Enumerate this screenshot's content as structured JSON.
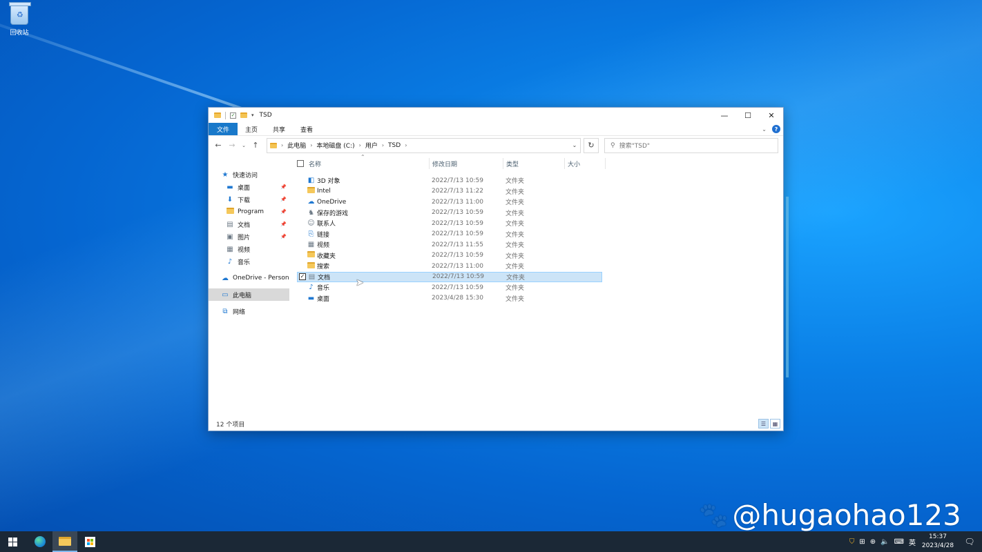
{
  "desktop": {
    "icons": [
      {
        "label": "回收站",
        "icon": "recycle-bin-icon"
      }
    ],
    "watermark": "@hugaohao123"
  },
  "window": {
    "title": "TSD",
    "ribbon_tabs": [
      "文件",
      "主页",
      "共享",
      "查看"
    ],
    "breadcrumb": [
      "此电脑",
      "本地磁盘 (C:)",
      "用户",
      "TSD"
    ],
    "search_placeholder": "搜索\"TSD\"",
    "nav": [
      {
        "label": "快速访问",
        "icon": "star-icon",
        "level": "top",
        "pinned": false
      },
      {
        "label": "桌面",
        "icon": "desktop-icon",
        "level": "sub",
        "pinned": true
      },
      {
        "label": "下载",
        "icon": "download-icon",
        "level": "sub",
        "pinned": true
      },
      {
        "label": "Program",
        "icon": "folder-icon",
        "level": "sub",
        "pinned": true
      },
      {
        "label": "文档",
        "icon": "document-icon",
        "level": "sub",
        "pinned": true
      },
      {
        "label": "图片",
        "icon": "picture-icon",
        "level": "sub",
        "pinned": true
      },
      {
        "label": "视频",
        "icon": "video-icon",
        "level": "sub",
        "pinned": false
      },
      {
        "label": "音乐",
        "icon": "music-icon",
        "level": "sub",
        "pinned": false
      },
      {
        "label": "OneDrive - Persona",
        "icon": "cloud-icon",
        "level": "top",
        "pinned": false
      },
      {
        "label": "此电脑",
        "icon": "computer-icon",
        "level": "top",
        "pinned": false,
        "selected": true
      },
      {
        "label": "网络",
        "icon": "network-icon",
        "level": "top",
        "pinned": false
      }
    ],
    "columns": [
      "名称",
      "修改日期",
      "类型",
      "大小"
    ],
    "files": [
      {
        "name": "3D 对象",
        "date": "2022/7/13 10:59",
        "type": "文件夹",
        "icon": "3d-objects-icon"
      },
      {
        "name": "Intel",
        "date": "2022/7/13 11:22",
        "type": "文件夹",
        "icon": "folder-icon"
      },
      {
        "name": "OneDrive",
        "date": "2022/7/13 11:00",
        "type": "文件夹",
        "icon": "cloud-icon"
      },
      {
        "name": "保存的游戏",
        "date": "2022/7/13 10:59",
        "type": "文件夹",
        "icon": "saved-games-icon"
      },
      {
        "name": "联系人",
        "date": "2022/7/13 10:59",
        "type": "文件夹",
        "icon": "contacts-icon"
      },
      {
        "name": "链接",
        "date": "2022/7/13 10:59",
        "type": "文件夹",
        "icon": "links-icon"
      },
      {
        "name": "视频",
        "date": "2022/7/13 11:55",
        "type": "文件夹",
        "icon": "video-icon"
      },
      {
        "name": "收藏夹",
        "date": "2022/7/13 10:59",
        "type": "文件夹",
        "icon": "favorites-icon"
      },
      {
        "name": "搜索",
        "date": "2022/7/13 11:00",
        "type": "文件夹",
        "icon": "search-folder-icon"
      },
      {
        "name": "文档",
        "date": "2022/7/13 10:59",
        "type": "文件夹",
        "icon": "document-icon",
        "selected": true
      },
      {
        "name": "音乐",
        "date": "2022/7/13 10:59",
        "type": "文件夹",
        "icon": "music-icon"
      },
      {
        "name": "桌面",
        "date": "2023/4/28 15:30",
        "type": "文件夹",
        "icon": "desktop-icon"
      }
    ],
    "status": "12 个项目"
  },
  "taskbar": {
    "apps": [
      "start-icon",
      "edge-icon",
      "file-explorer-icon",
      "store-icon"
    ],
    "ime": "英",
    "time": "15:37",
    "date": "2023/4/28"
  },
  "colors": {
    "accent": "#1979ca",
    "selection": "#cce4f7",
    "taskbar": "#1b2836"
  }
}
